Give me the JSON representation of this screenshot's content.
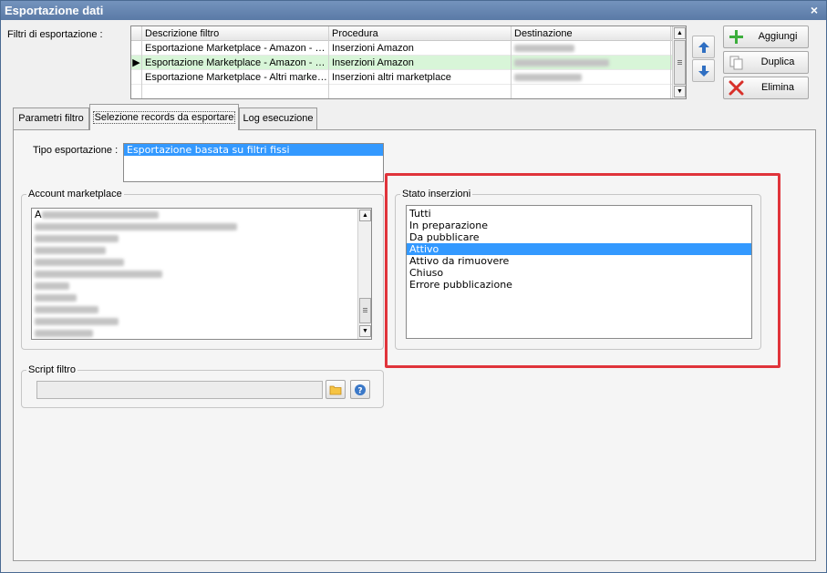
{
  "window": {
    "title": "Esportazione dati",
    "close_glyph": "×"
  },
  "filters": {
    "label": "Filtri di esportazione :",
    "columns": [
      "Descrizione filtro",
      "Procedura",
      "Destinazione"
    ],
    "rows": [
      {
        "pointer": "",
        "descrizione": "Esportazione Marketplace - Amazon - G...",
        "procedura": "Inserzioni Amazon"
      },
      {
        "pointer": "▶",
        "descrizione": "Esportazione Marketplace - Amazon - G...",
        "procedura": "Inserzioni Amazon"
      },
      {
        "pointer": "",
        "descrizione": "Esportazione Marketplace - Altri market...",
        "procedura": "Inserzioni altri marketplace"
      }
    ]
  },
  "actions": {
    "add": "Aggiungi",
    "duplicate": "Duplica",
    "delete": "Elimina",
    "move_up_icon": "arrow-up-icon",
    "move_down_icon": "arrow-down-icon"
  },
  "tabs": [
    {
      "label": "Parametri filtro",
      "active": false
    },
    {
      "label": "Selezione records da esportare",
      "active": true
    },
    {
      "label": "Log esecuzione",
      "active": false
    }
  ],
  "tipo_esportazione": {
    "label": "Tipo esportazione :",
    "options": [
      "Esportazione basata su filtri fissi"
    ],
    "selected": "Esportazione basata su filtri fissi"
  },
  "account_marketplace": {
    "title": "Account marketplace",
    "first_item": "A"
  },
  "stato_inserzioni": {
    "title": "Stato inserzioni",
    "options": [
      "Tutti",
      "In preparazione",
      "Da pubblicare",
      "Attivo",
      "Attivo da rimuovere",
      "Chiuso",
      "Errore pubblicazione"
    ],
    "selected": "Attivo"
  },
  "script_filtro": {
    "title": "Script filtro",
    "value": "",
    "folder_icon": "folder-icon",
    "help_icon": "help-icon"
  },
  "colors": {
    "selection": "#3399ff",
    "grid_selected_row": "#d8f5d8",
    "highlight_box": "#e0343b",
    "titlebar": "#5a7aa6"
  }
}
